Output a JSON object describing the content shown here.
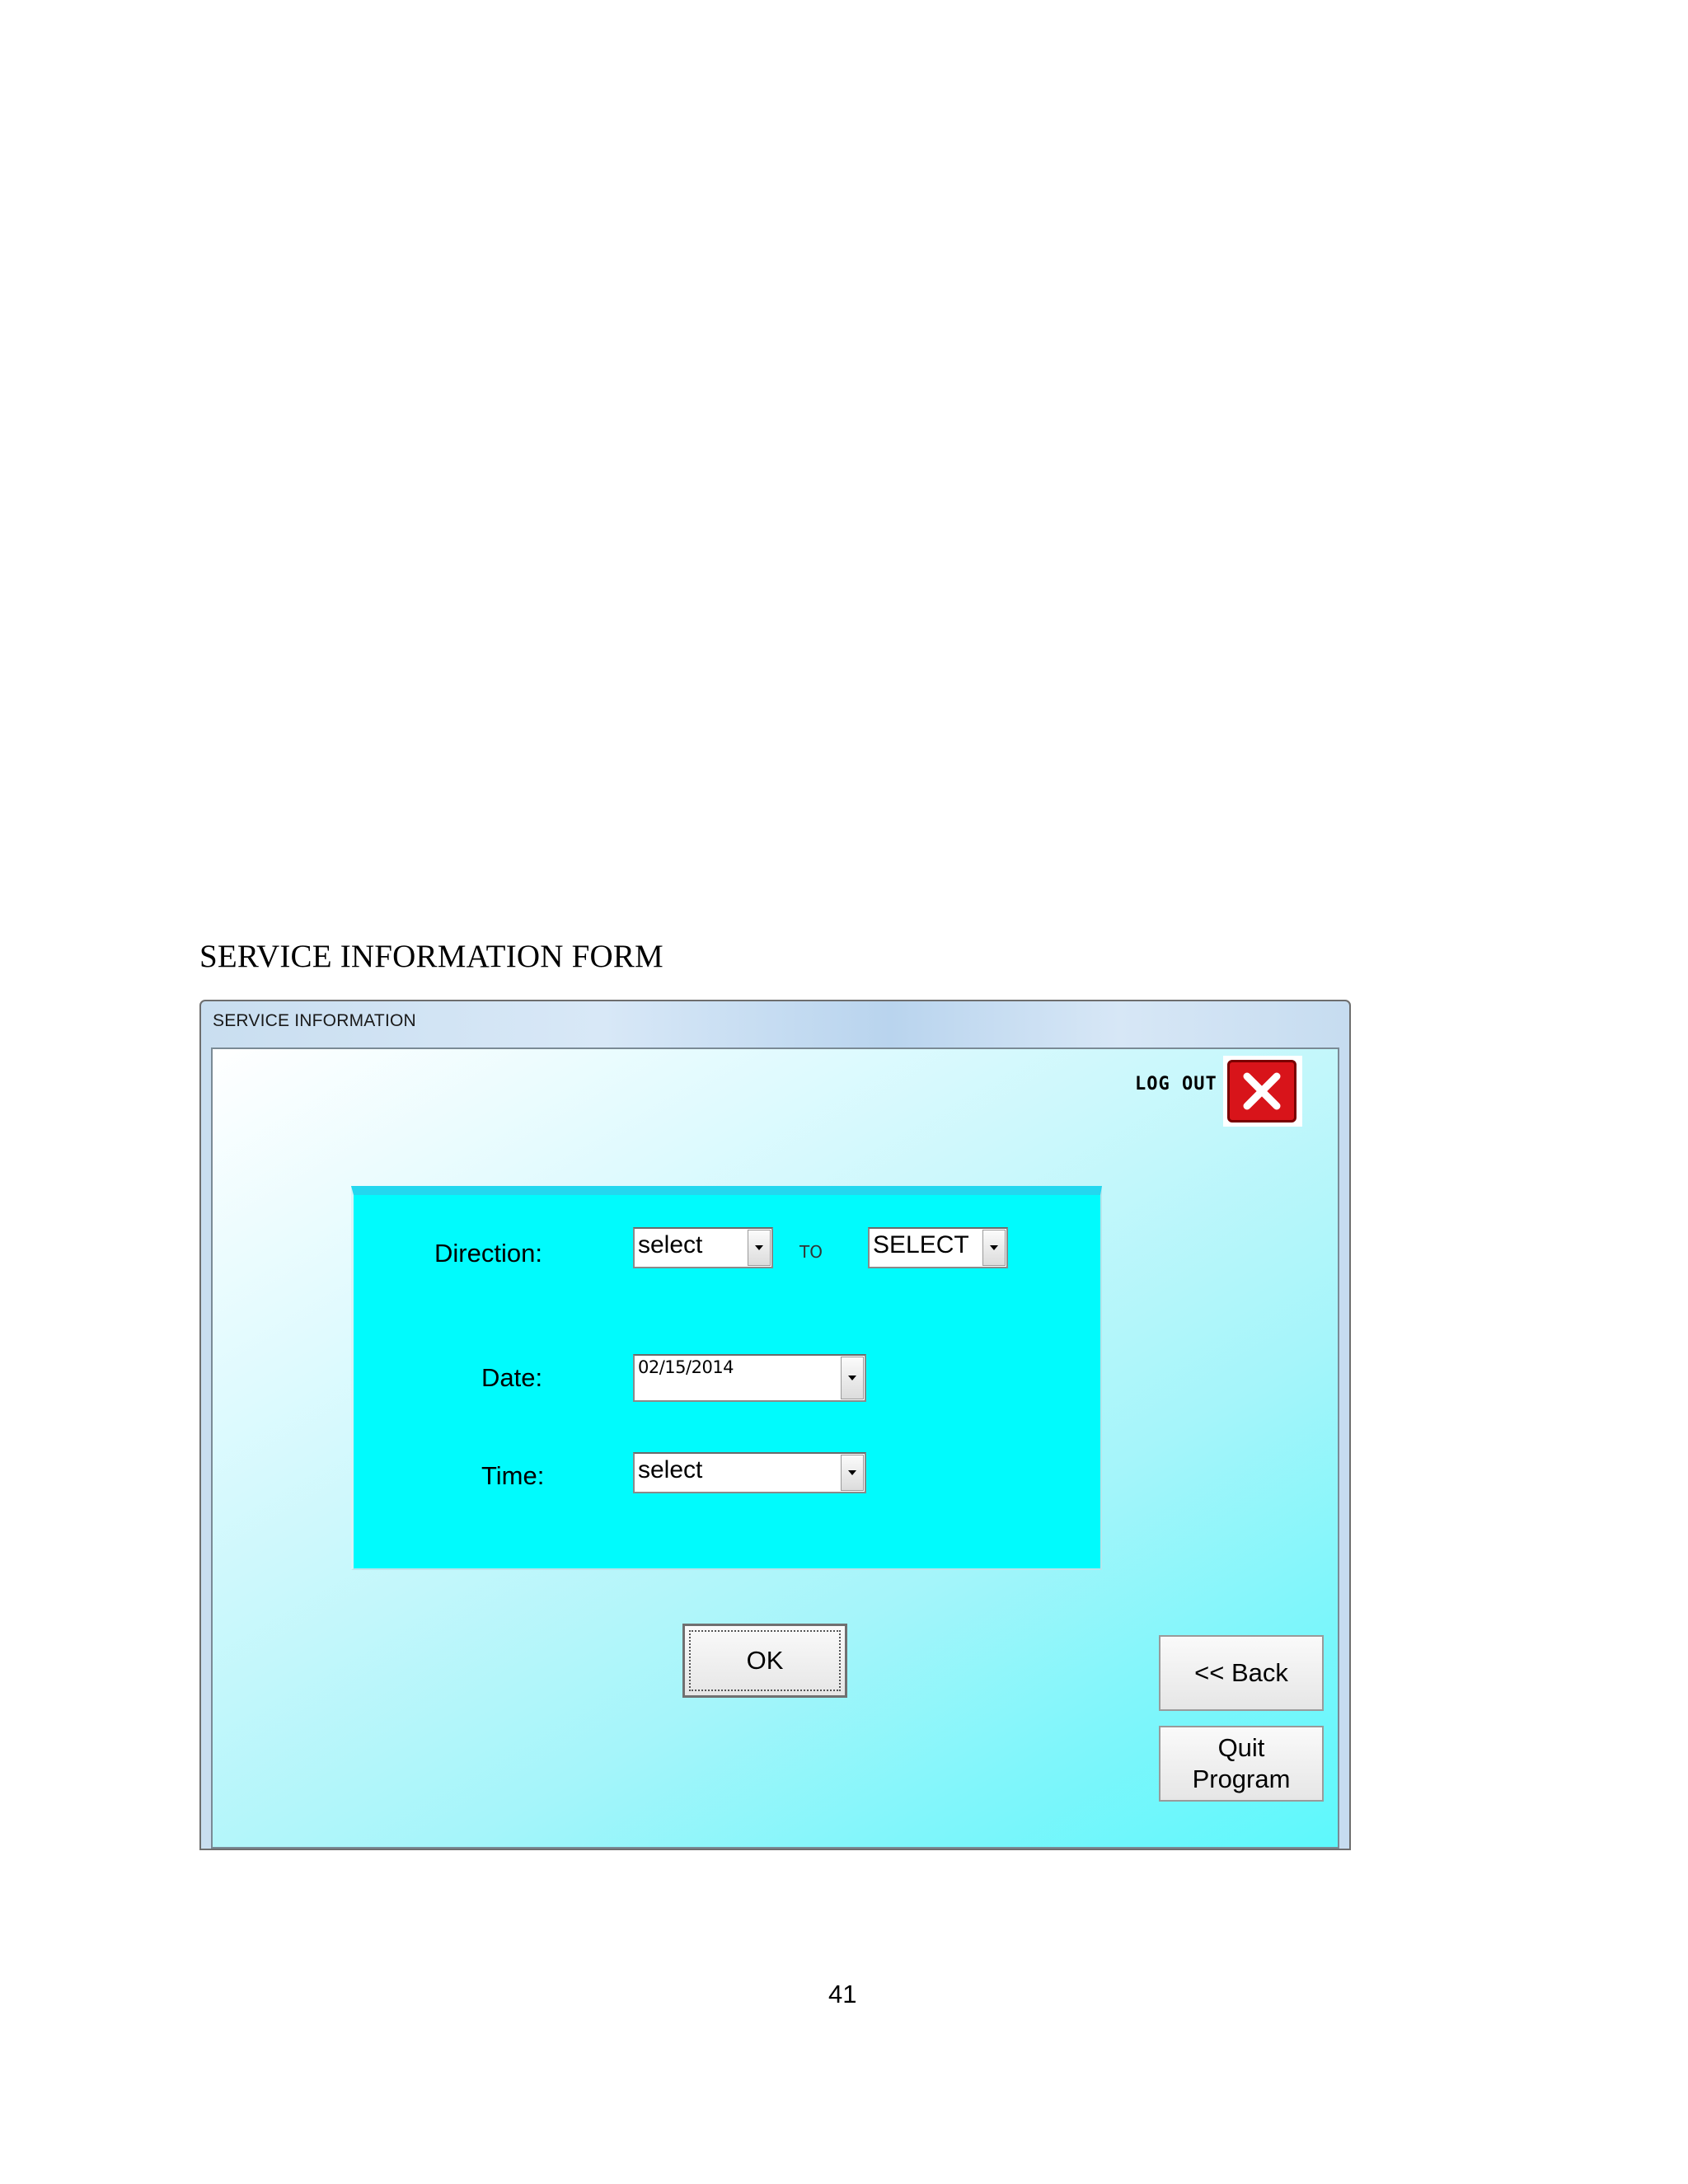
{
  "document": {
    "caption": "SERVICE INFORMATION FORM",
    "page_number": "41"
  },
  "window": {
    "title": "SERVICE INFORMATION"
  },
  "logout": {
    "label": "LOG OUT",
    "icon": "close-x-icon",
    "icon_color": "#d8141a"
  },
  "form": {
    "direction": {
      "label": "Direction:",
      "from_value": "select",
      "to_label": "TO",
      "to_value": "SELECT"
    },
    "date": {
      "label": "Date:",
      "value": "02/15/2014"
    },
    "time": {
      "label": "Time:",
      "value": "select"
    },
    "panel_color": "#00fbfd"
  },
  "buttons": {
    "ok": "OK",
    "back": "<< Back",
    "quit_line1": "Quit",
    "quit_line2": "Program"
  }
}
